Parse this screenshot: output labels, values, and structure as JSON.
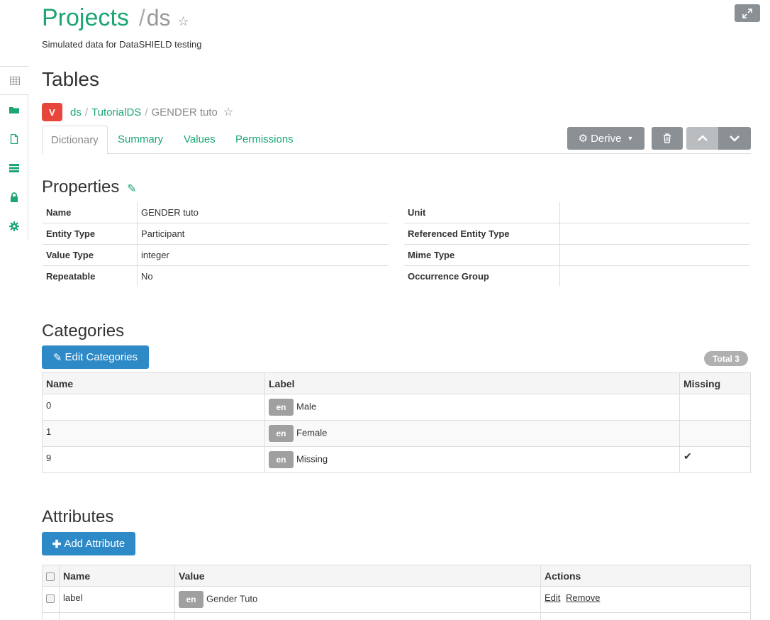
{
  "header": {
    "title": "Projects",
    "separator": "/",
    "project": "ds",
    "description": "Simulated data for DataSHIELD testing"
  },
  "page_title": "Tables",
  "breadcrumb": {
    "badge": "V",
    "items": [
      "ds",
      "TutorialDS"
    ],
    "current": "GENDER tuto"
  },
  "tabs": [
    "Dictionary",
    "Summary",
    "Values",
    "Permissions"
  ],
  "toolbar": {
    "derive_label": "Derive"
  },
  "properties": {
    "title": "Properties",
    "left": [
      {
        "key": "Name",
        "value": "GENDER tuto"
      },
      {
        "key": "Entity Type",
        "value": "Participant"
      },
      {
        "key": "Value Type",
        "value": "integer"
      },
      {
        "key": "Repeatable",
        "value": "No"
      }
    ],
    "right": [
      {
        "key": "Unit",
        "value": ""
      },
      {
        "key": "Referenced Entity Type",
        "value": ""
      },
      {
        "key": "Mime Type",
        "value": ""
      },
      {
        "key": "Occurrence Group",
        "value": ""
      }
    ]
  },
  "categories": {
    "title": "Categories",
    "edit_label": "Edit Categories",
    "total_label": "Total 3",
    "headers": [
      "Name",
      "Label",
      "Missing"
    ],
    "rows": [
      {
        "name": "0",
        "lang": "en",
        "label": "Male",
        "missing": false
      },
      {
        "name": "1",
        "lang": "en",
        "label": "Female",
        "missing": false
      },
      {
        "name": "9",
        "lang": "en",
        "label": "Missing",
        "missing": true
      }
    ]
  },
  "attributes": {
    "title": "Attributes",
    "add_label": "Add Attribute",
    "headers": [
      "Name",
      "Value",
      "Actions"
    ],
    "rows": [
      {
        "name": "label",
        "lang": "en",
        "value": "Gender Tuto",
        "actions": [
          "Edit",
          "Remove"
        ]
      }
    ]
  },
  "colors": {
    "accent": "#1ba672",
    "primary": "#2d8ac7",
    "danger": "#e8453c",
    "grey": "#8a9094"
  }
}
